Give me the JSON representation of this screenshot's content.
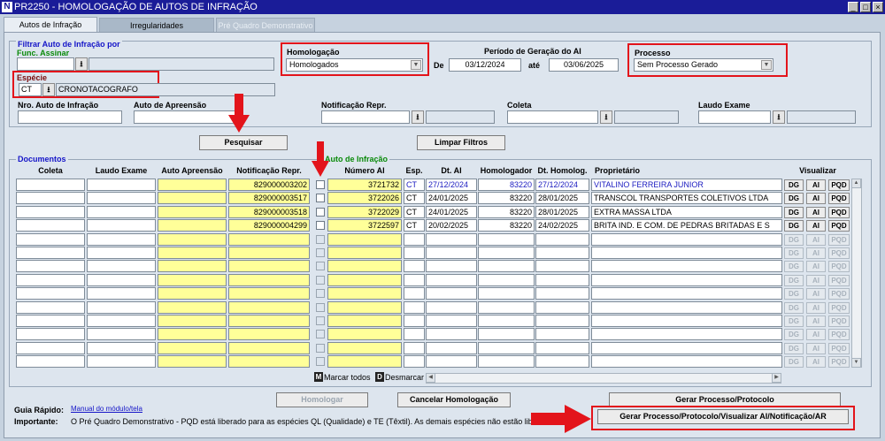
{
  "window": {
    "title": "PR2250 - HOMOLOGAÇÃO DE AUTOS DE INFRAÇÃO",
    "icon_letter": "N"
  },
  "tabs": [
    {
      "label": "Autos de Infração",
      "state": "active"
    },
    {
      "label": "Irregularidades",
      "state": "inactive"
    },
    {
      "label": "Pré Quadro Demonstrativo",
      "state": "disabled"
    }
  ],
  "filter": {
    "title": "Filtrar Auto de Infração por",
    "func_assinar_label": "Func. Assinar",
    "func_assinar_code": "",
    "func_assinar_name": "",
    "especie_label": "Espécie",
    "especie_code": "CT",
    "especie_name": "CRONOTACOGRAFO",
    "homologacao_label": "Homologação",
    "homologacao_value": "Homologados",
    "periodo_label": "Período de Geração do AI",
    "de_label": "De",
    "de_value": "03/12/2024",
    "ate_label": "até",
    "ate_value": "03/06/2025",
    "processo_label": "Processo",
    "processo_value": "Sem Processo Gerado",
    "nro_auto_label": "Nro. Auto de Infração",
    "auto_apreensao_label": "Auto de Apreensão",
    "notificacao_label": "Notificação Repr.",
    "coleta_label": "Coleta",
    "laudo_label": "Laudo Exame",
    "pesquisar_label": "Pesquisar",
    "limpar_label": "Limpar Filtros"
  },
  "documents": {
    "section_label": "Documentos",
    "auto_section_label": "Auto de Infração",
    "headers": {
      "coleta": "Coleta",
      "laudo": "Laudo Exame",
      "auto_apreensao": "Auto Apreensão",
      "notificacao": "Notificação Repr.",
      "numero_ai": "Número AI",
      "esp": "Esp.",
      "dt_ai": "Dt. AI",
      "homologador": "Homologador",
      "dt_homolog": "Dt. Homolog.",
      "proprietario": "Proprietário",
      "visualizar": "Visualizar"
    },
    "rows": [
      {
        "coleta": "",
        "laudo": "",
        "auto_apreensao": "",
        "notificacao": "829000003202",
        "numero_ai": "3721732",
        "esp": "CT",
        "dt_ai": "27/12/2024",
        "homologador": "83220",
        "dt_homolog": "27/12/2024",
        "proprietario": "VITALINO FERREIRA JUNIOR",
        "selected": true
      },
      {
        "coleta": "",
        "laudo": "",
        "auto_apreensao": "",
        "notificacao": "829000003517",
        "numero_ai": "3722026",
        "esp": "CT",
        "dt_ai": "24/01/2025",
        "homologador": "83220",
        "dt_homolog": "28/01/2025",
        "proprietario": "TRANSCOL TRANSPORTES COLETIVOS LTDA",
        "selected": false
      },
      {
        "coleta": "",
        "laudo": "",
        "auto_apreensao": "",
        "notificacao": "829000003518",
        "numero_ai": "3722029",
        "esp": "CT",
        "dt_ai": "24/01/2025",
        "homologador": "83220",
        "dt_homolog": "28/01/2025",
        "proprietario": "EXTRA MASSA LTDA",
        "selected": false
      },
      {
        "coleta": "",
        "laudo": "",
        "auto_apreensao": "",
        "notificacao": "829000004299",
        "numero_ai": "3722597",
        "esp": "CT",
        "dt_ai": "20/02/2025",
        "homologador": "83220",
        "dt_homolog": "24/02/2025",
        "proprietario": "BRITA IND. E COM. DE PEDRAS BRITADAS E S",
        "selected": false
      }
    ],
    "empty_rows": 10,
    "view_buttons": [
      "DG",
      "AI",
      "PQD"
    ],
    "marcar_key": "M",
    "marcar_label": "Marcar todos",
    "desmarcar_key": "D",
    "desmarcar_label": "Desmarcar"
  },
  "actions": {
    "homologar": "Homologar",
    "cancelar": "Cancelar Homologação",
    "gerar": "Gerar Processo/Protocolo",
    "gerar_visualizar": "Gerar Processo/Protocolo/Visualizar AI/Notificação/AR"
  },
  "footer": {
    "guia_label": "Guia Rápido:",
    "guia_link": "Manual do módulo/tela",
    "importante_label": "Importante:",
    "importante_text": "O Pré Quadro Demonstrativo - PQD está liberado para as espécies QL (Qualidade) e TE (Têxtil). As demais espécies não estão libe"
  },
  "colors": {
    "title_bar": "#1a1c98",
    "highlight": "#e3141b",
    "yellow_field": "#ffff99",
    "label_blue": "#1515c8",
    "label_green": "#0a8a0a"
  }
}
